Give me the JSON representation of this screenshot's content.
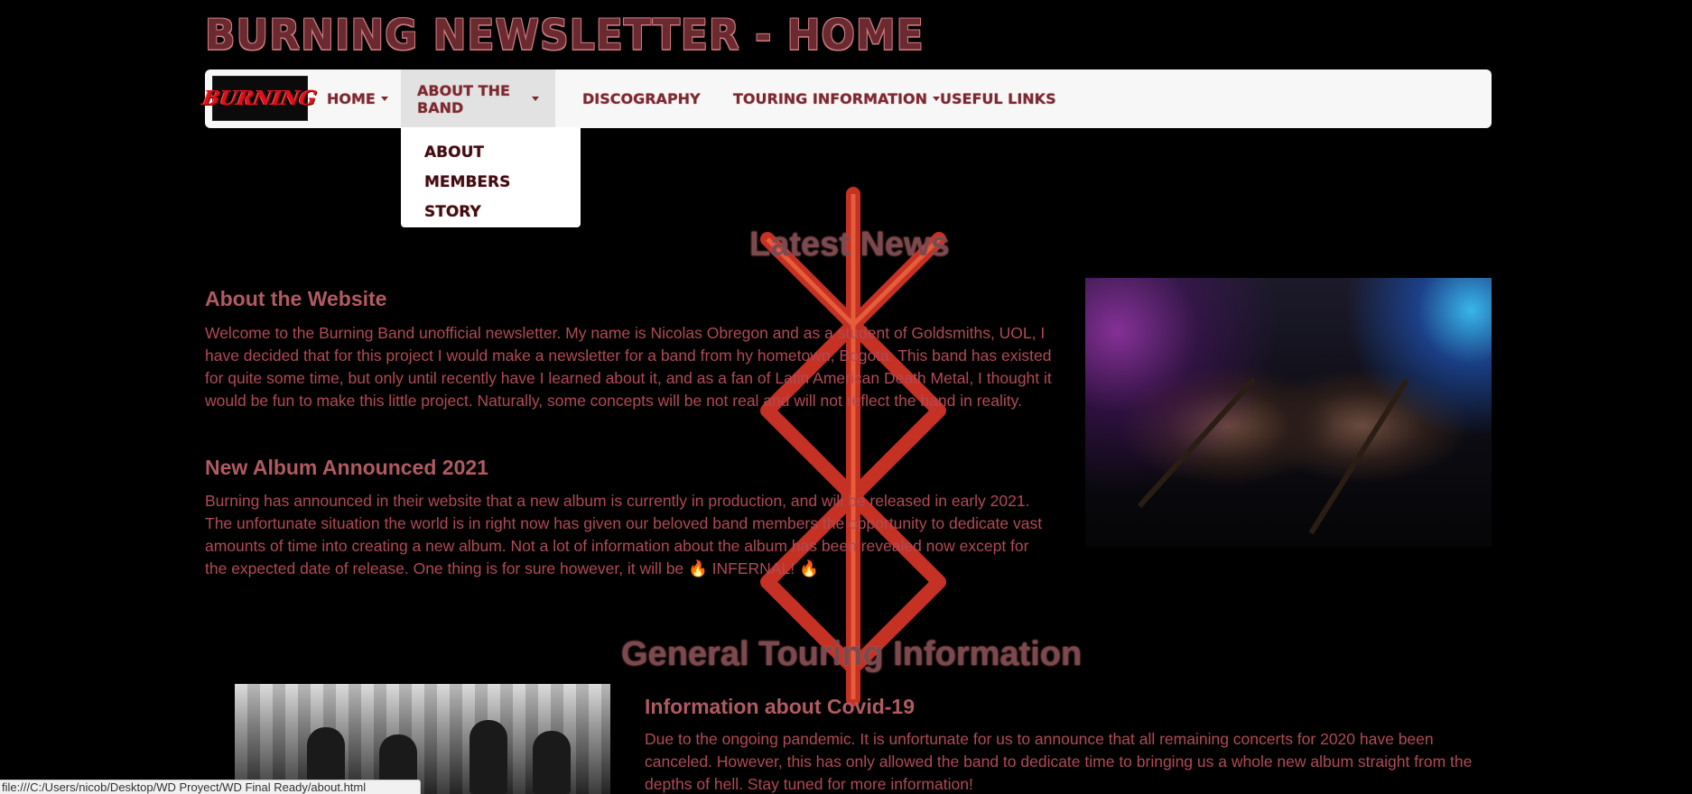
{
  "site": {
    "title": "BURNING NEWSLETTER - HOME"
  },
  "navbar": {
    "brand_text": "BURNING",
    "items": [
      {
        "label": "HOME",
        "has_caret": true
      },
      {
        "label": "ABOUT THE BAND",
        "has_caret": true,
        "active": true
      },
      {
        "label": "DISCOGRAPHY",
        "has_caret": false
      },
      {
        "label": "TOURING INFORMATION",
        "has_caret": true
      },
      {
        "label": "USEFUL LINKS",
        "has_caret": false
      }
    ]
  },
  "dropdown": {
    "items": [
      "ABOUT",
      "MEMBERS",
      "STORY"
    ]
  },
  "latest_news": {
    "title": "Latest News",
    "articles": [
      {
        "title": "About the Website",
        "body": "Welcome to the Burning Band unofficial newsletter. My name is Nicolas Obregon and as a student of Goldsmiths, UOL, I have decided that for this project I would make a newsletter for a band from hy hometown, Bogota. This band has existed for quite some time, but only until recently have I learned about it, and as a fan of Latin American Death Metal, I thought it would be fun to make this little project. Naturally, some concepts will be not real and will not reflect the band in reality."
      },
      {
        "title": "New Album Announced 2021",
        "body": "Burning has announced in their website that a new album is currently in production, and will be released in early 2021. The unfortunate situation the world is in right now has given our beloved band members the opportunity to dedicate vast amounts of time into creating a new album. Not a lot of information about the album has been revealed now except for the expected date of release. One thing is for sure however, it will be 🔥 INFERNAL! 🔥"
      }
    ]
  },
  "touring": {
    "title": "General Touring Information",
    "article": {
      "title": "Information about Covid-19",
      "body": "Due to the ongoing pandemic. It is unfortunate for us to announce that all remaining concerts for 2020 have been canceled. However, this has only allowed the band to dedicate time to bringing us a whole new album straight from the depths of hell. Stay tuned for more information!"
    }
  },
  "status_bar": {
    "url": "file:///C:/Users/nicob/Desktop/WD Proyect/WD Final Ready/about.html"
  },
  "colors": {
    "background": "#000000",
    "navbar_bg": "#f7f7f7",
    "accent_red": "#b04a55",
    "title_red": "#6b2a30"
  }
}
